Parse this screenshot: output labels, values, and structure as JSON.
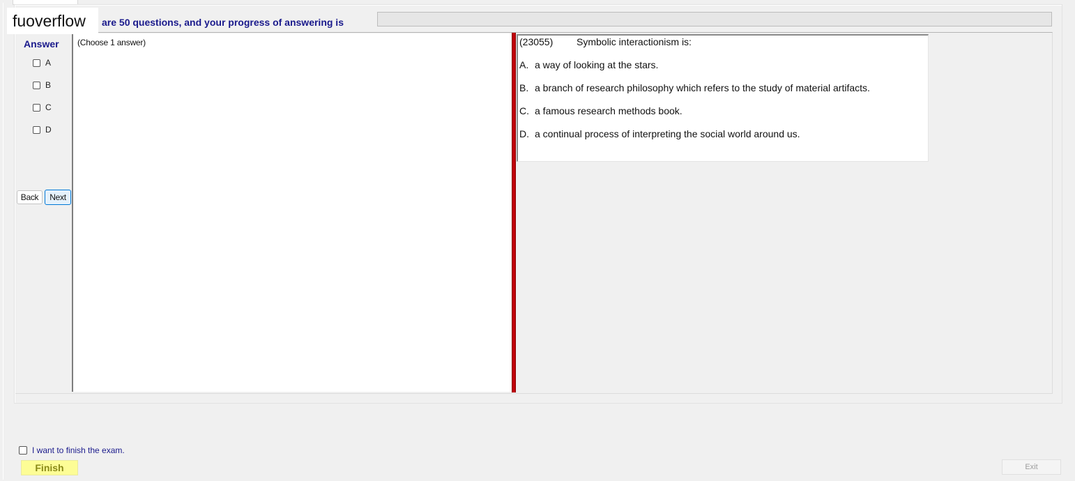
{
  "header": {
    "progress_text": "are 50 questions, and your progress of answering is",
    "progress_fraction": 0
  },
  "watermark": "fuoverflow",
  "answer_panel": {
    "heading": "Answer",
    "options": [
      "A",
      "B",
      "C",
      "D"
    ],
    "back_label": "Back",
    "next_label": "Next"
  },
  "left_pane": {
    "instruction": "(Choose 1 answer)"
  },
  "question": {
    "number": "(23055)",
    "text": "Symbolic interactionism is:",
    "choices": [
      {
        "letter": "A.",
        "text": "a way of looking at the stars."
      },
      {
        "letter": "B.",
        "text": "a branch of research philosophy which refers to the study of material artifacts."
      },
      {
        "letter": "C.",
        "text": "a famous research methods book."
      },
      {
        "letter": "D.",
        "text": "a continual process of interpreting the social world around us."
      }
    ]
  },
  "footer": {
    "finish_checkbox_label": "I want to finish the exam.",
    "finish_label": "Finish",
    "exit_label": "Exit"
  },
  "colors": {
    "accent_text": "#1a1a8c",
    "splitter": "#c0000b",
    "finish_bg": "#fdfd96"
  }
}
